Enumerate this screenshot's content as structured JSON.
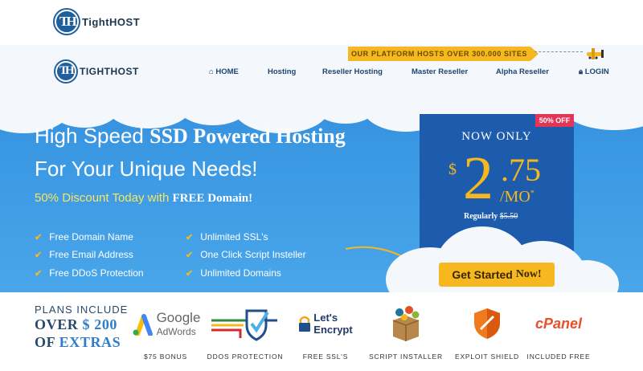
{
  "brand": {
    "name": "TightHOST",
    "name_nav": "TIGHTHOST",
    "mark": "TH"
  },
  "banner": "OUR PLATFORM HOSTS OVER 300.000 SITES",
  "nav": {
    "items": [
      {
        "label": "HOME",
        "icon": "home-icon"
      },
      {
        "label": "Hosting"
      },
      {
        "label": "Reseller Hosting"
      },
      {
        "label": "Master Reseller"
      },
      {
        "label": "Alpha Reseller"
      },
      {
        "label": "LOGIN",
        "icon": "lock-icon"
      }
    ]
  },
  "hero": {
    "headline_1_plain": "High Speed ",
    "headline_1_bold": "SSD Powered Hosting",
    "headline_2": "For Your Unique Needs!",
    "sub_plain": "50% Discount Today with ",
    "sub_bold": "FREE Domain!",
    "features": [
      "Free Domain Name",
      "Free Email Address",
      "Free DDoS Protection",
      "Unlimited SSL's",
      "One Click Script Insteller",
      "Unlimited Domains"
    ]
  },
  "pricing": {
    "badge": "50% OFF",
    "now_only": "NOW ONLY",
    "currency": "$",
    "integer": "2",
    "decimal": ".75",
    "per": "/MO",
    "asterisk": "*",
    "regular_label": "Regularly ",
    "regular_price": "$5.50",
    "cta_plain": "Get Started ",
    "cta_bold": "Now!"
  },
  "extras": {
    "line1": "PLANS INCLUDE",
    "line2a": "OVER ",
    "line2b": "$ 200",
    "line3a": "OF ",
    "line3b": "EXTRAS",
    "partners": [
      {
        "logo": "Google",
        "logo2": "AdWords",
        "caption": "$75 BONUS"
      },
      {
        "caption": "DDOS PROTECTION"
      },
      {
        "logo": "Let's",
        "logo2": "Encrypt",
        "caption": "FREE SSL'S"
      },
      {
        "caption": "SCRIPT INSTALLER"
      },
      {
        "caption": "EXPLOIT SHIELD"
      },
      {
        "logo": "cPanel",
        "caption": "INCLUDED FREE"
      }
    ]
  },
  "colors": {
    "accent": "#f6b81e",
    "hero_blue": "#3a97e2",
    "price_box": "#1d5cad",
    "badge": "#e33555"
  }
}
